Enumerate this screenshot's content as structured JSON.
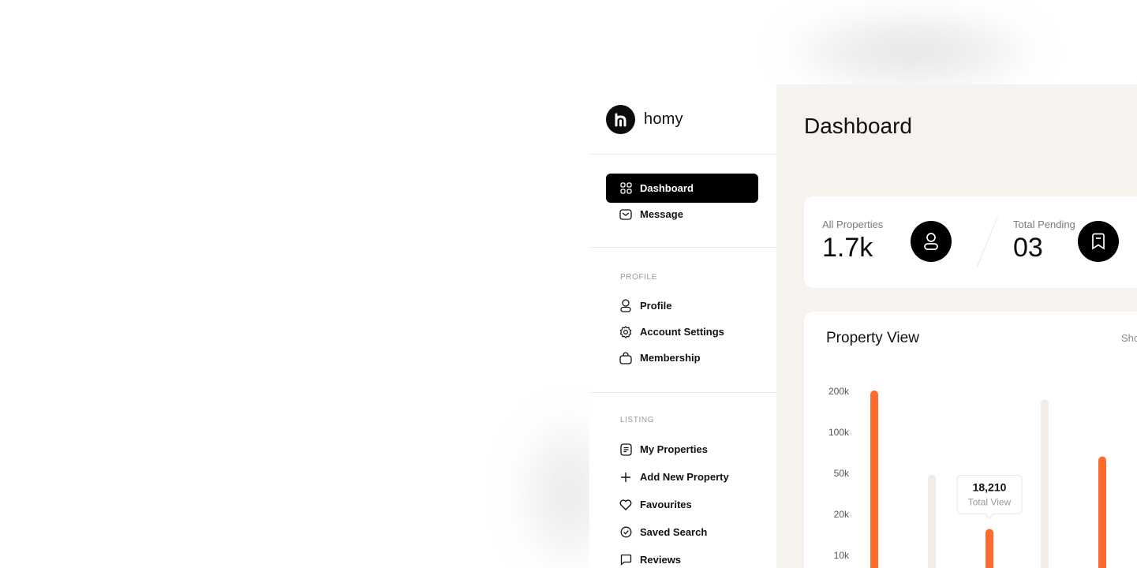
{
  "brand": {
    "name": "homy"
  },
  "sidebar": {
    "main_items": [
      {
        "label": "Dashboard",
        "icon": "grid-icon",
        "active": true
      },
      {
        "label": "Message",
        "icon": "mail-icon",
        "active": false
      }
    ],
    "profile_section": {
      "label": "PROFILE",
      "items": [
        {
          "label": "Profile",
          "icon": "user-icon"
        },
        {
          "label": "Account Settings",
          "icon": "gear-icon"
        },
        {
          "label": "Membership",
          "icon": "bag-icon"
        }
      ]
    },
    "listing_section": {
      "label": "LISTING",
      "items": [
        {
          "label": "My Properties",
          "icon": "document-icon"
        },
        {
          "label": "Add New Property",
          "icon": "plus-icon"
        },
        {
          "label": "Favourites",
          "icon": "heart-icon"
        },
        {
          "label": "Saved Search",
          "icon": "check-circle-icon"
        },
        {
          "label": "Reviews",
          "icon": "chat-icon"
        }
      ]
    }
  },
  "main": {
    "title": "Dashboard",
    "stats": [
      {
        "label": "All Properties",
        "value": "1.7k",
        "icon": "user-icon"
      },
      {
        "label": "Total Pending",
        "value": "03",
        "icon": "bookmark-icon"
      }
    ],
    "chart_card": {
      "title": "Property View",
      "show_label": "Sho"
    }
  },
  "colors": {
    "accent": "#ff6b2c",
    "bar_muted": "#f3ece6",
    "panel_bg": "#f6f2ee",
    "active_bg": "#000000"
  },
  "chart_data": {
    "type": "bar",
    "title": "Property View",
    "y_ticks": [
      "200k",
      "100k",
      "50k",
      "20k",
      "10k"
    ],
    "y_scale": "log",
    "series": [
      {
        "values": [
          200000,
          43000,
          16000,
          170000,
          60000
        ]
      }
    ],
    "highlight_colors": [
      "#ff6b2c",
      "#f3ece6",
      "#ff6b2c",
      "#f3ece6",
      "#ff6b2c"
    ],
    "tooltip": {
      "value": "18,210",
      "label": "Total View"
    }
  }
}
